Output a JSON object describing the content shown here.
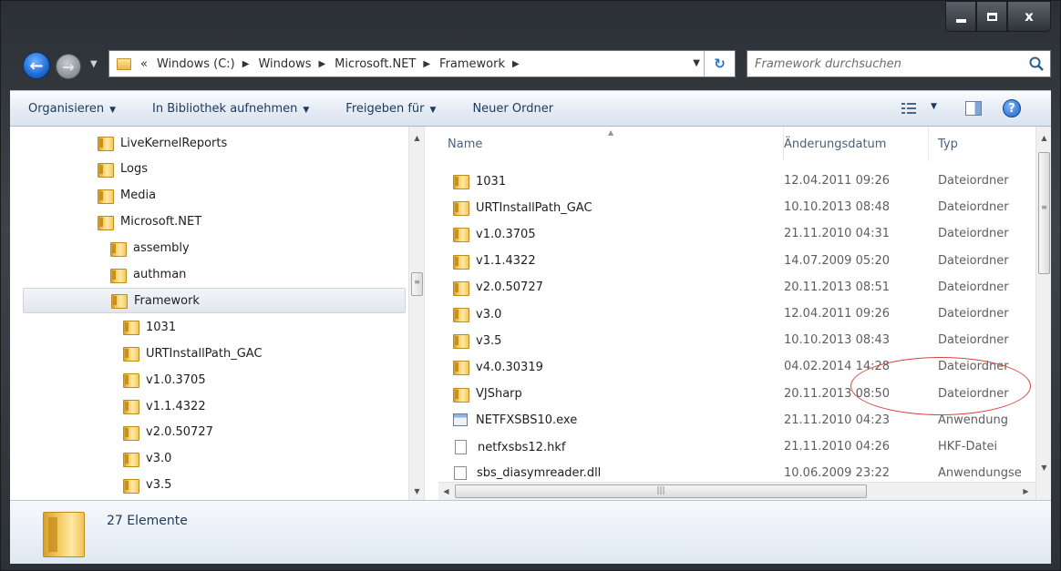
{
  "window": {
    "controls": {
      "close_label": "x"
    }
  },
  "address": {
    "overflow": "«",
    "crumbs": [
      "Windows (C:)",
      "Windows",
      "Microsoft.NET",
      "Framework"
    ]
  },
  "search": {
    "placeholder": "Framework durchsuchen"
  },
  "toolbar": {
    "organize": "Organisieren",
    "include_library": "In Bibliothek aufnehmen",
    "share": "Freigeben für",
    "new_folder": "Neuer Ordner"
  },
  "nav_tree": [
    {
      "label": "LiveKernelReports",
      "level": 0,
      "selected": false
    },
    {
      "label": "Logs",
      "level": 0,
      "selected": false
    },
    {
      "label": "Media",
      "level": 0,
      "selected": false
    },
    {
      "label": "Microsoft.NET",
      "level": 0,
      "selected": false
    },
    {
      "label": "assembly",
      "level": 1,
      "selected": false
    },
    {
      "label": "authman",
      "level": 1,
      "selected": false
    },
    {
      "label": "Framework",
      "level": 1,
      "selected": true
    },
    {
      "label": "1031",
      "level": 2,
      "selected": false
    },
    {
      "label": "URTInstallPath_GAC",
      "level": 2,
      "selected": false
    },
    {
      "label": "v1.0.3705",
      "level": 2,
      "selected": false
    },
    {
      "label": "v1.1.4322",
      "level": 2,
      "selected": false
    },
    {
      "label": "v2.0.50727",
      "level": 2,
      "selected": false
    },
    {
      "label": "v3.0",
      "level": 2,
      "selected": false
    },
    {
      "label": "v3.5",
      "level": 2,
      "selected": false
    }
  ],
  "columns": {
    "name": "Name",
    "date": "Änderungsdatum",
    "type": "Typ"
  },
  "files": [
    {
      "name": "1031",
      "date": "12.04.2011 09:26",
      "type": "Dateiordner",
      "icon": "folder"
    },
    {
      "name": "URTInstallPath_GAC",
      "date": "10.10.2013 08:48",
      "type": "Dateiordner",
      "icon": "folder"
    },
    {
      "name": "v1.0.3705",
      "date": "21.11.2010 04:31",
      "type": "Dateiordner",
      "icon": "folder"
    },
    {
      "name": "v1.1.4322",
      "date": "14.07.2009 05:20",
      "type": "Dateiordner",
      "icon": "folder"
    },
    {
      "name": "v2.0.50727",
      "date": "20.11.2013 08:51",
      "type": "Dateiordner",
      "icon": "folder"
    },
    {
      "name": "v3.0",
      "date": "12.04.2011 09:26",
      "type": "Dateiordner",
      "icon": "folder"
    },
    {
      "name": "v3.5",
      "date": "10.10.2013 08:43",
      "type": "Dateiordner",
      "icon": "folder"
    },
    {
      "name": "v4.0.30319",
      "date": "04.02.2014 14:28",
      "type": "Dateiordner",
      "icon": "folder"
    },
    {
      "name": "VJSharp",
      "date": "20.11.2013 08:50",
      "type": "Dateiordner",
      "icon": "folder"
    },
    {
      "name": "NETFXSBS10.exe",
      "date": "21.11.2010 04:23",
      "type": "Anwendung",
      "icon": "exe"
    },
    {
      "name": "netfxsbs12.hkf",
      "date": "21.11.2010 04:26",
      "type": "HKF-Datei",
      "icon": "document"
    },
    {
      "name": "sbs_diasymreader.dll",
      "date": "10.06.2009 23:22",
      "type": "Anwendungse",
      "icon": "dll"
    }
  ],
  "status": {
    "count": "27 Elemente"
  },
  "annotation": {
    "color": "#d9443f"
  }
}
